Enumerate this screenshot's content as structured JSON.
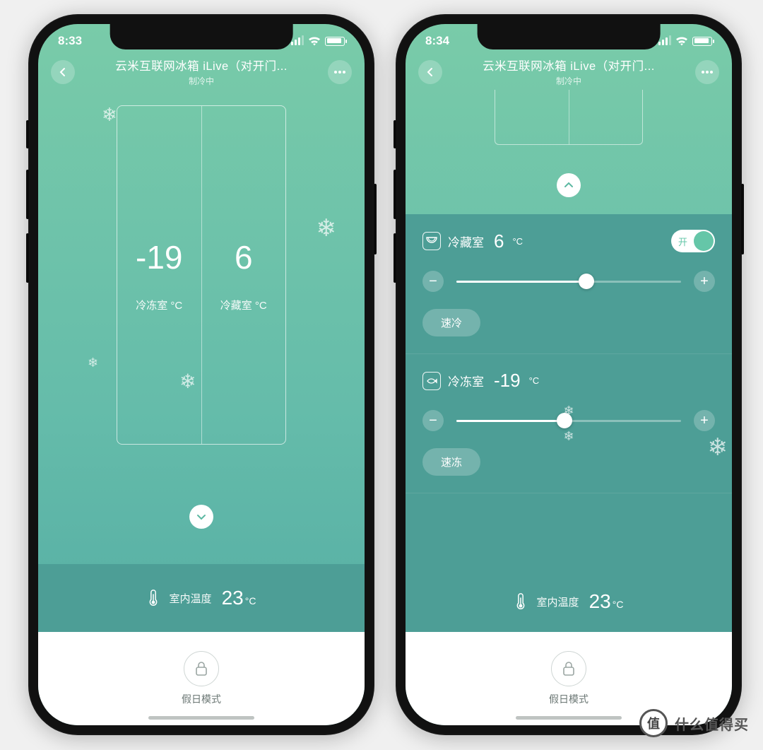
{
  "left": {
    "status_time": "8:33",
    "header_title": "云米互联网冰箱 iLive（对开门...",
    "header_sub": "制冷中",
    "freezer_temp": "-19",
    "freezer_label": "冷冻室 °C",
    "fridge_temp": "6",
    "fridge_label": "冷藏室 °C",
    "room_label": "室内温度",
    "room_temp": "23",
    "room_unit": "°C",
    "mode_label": "假日模式"
  },
  "right": {
    "status_time": "8:34",
    "header_title": "云米互联网冰箱 iLive（对开门...",
    "header_sub": "制冷中",
    "cold": {
      "title": "冷藏室",
      "temp": "6",
      "unit": "°C",
      "toggle_text": "开",
      "quick_label": "速冷",
      "slider_percent": 58
    },
    "freeze": {
      "title": "冷冻室",
      "temp": "-19",
      "unit": "°C",
      "quick_label": "速冻",
      "slider_percent": 48
    },
    "room_label": "室内温度",
    "room_temp": "23",
    "room_unit": "°C",
    "mode_label": "假日模式"
  },
  "watermark": {
    "badge": "值",
    "text": "什么值得买"
  }
}
